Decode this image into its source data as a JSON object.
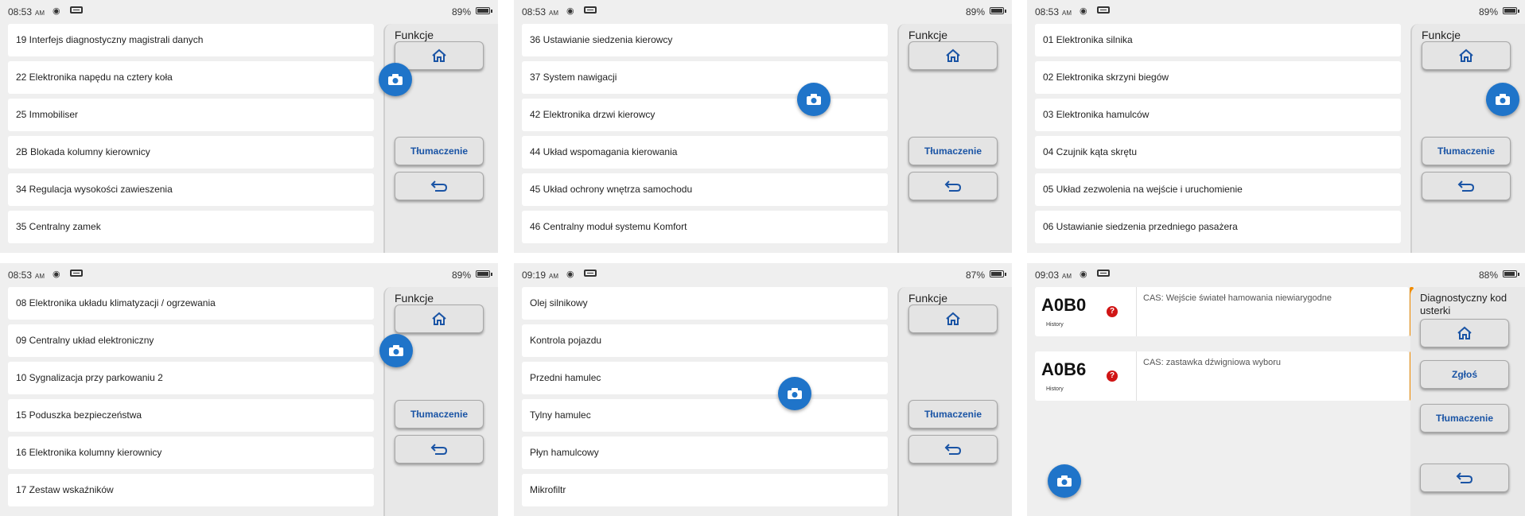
{
  "screens": [
    {
      "status": {
        "time": "08:53",
        "ampm": "AM",
        "battery": "89%",
        "battery_level": 0.89
      },
      "items": [
        "19 Interfejs diagnostyczny magistrali danych",
        "22 Elektronika napędu na cztery koła",
        "25 Immobiliser",
        "2B Blokada kolumny kierownicy",
        "34 Regulacja wysokości zawieszenia",
        "35 Centralny zamek"
      ],
      "panel": {
        "title": "Funkcje",
        "translate_label": "Tłumaczenie"
      }
    },
    {
      "status": {
        "time": "08:53",
        "ampm": "AM",
        "battery": "89%",
        "battery_level": 0.89
      },
      "items": [
        "36 Ustawianie siedzenia kierowcy",
        "37 System nawigacji",
        "42 Elektronika drzwi kierowcy",
        "44 Układ wspomagania kierowania",
        "45 Układ ochrony wnętrza samochodu",
        "46 Centralny moduł systemu Komfort"
      ],
      "panel": {
        "title": "Funkcje",
        "translate_label": "Tłumaczenie"
      }
    },
    {
      "status": {
        "time": "08:53",
        "ampm": "AM",
        "battery": "89%",
        "battery_level": 0.89
      },
      "items": [
        "01 Elektronika silnika",
        "02 Elektronika skrzyni biegów",
        "03 Elektronika hamulców",
        "04 Czujnik kąta skrętu",
        "05 Układ zezwolenia na wejście i uruchomienie",
        "06 Ustawianie siedzenia przedniego pasażera"
      ],
      "panel": {
        "title": "Funkcje",
        "translate_label": "Tłumaczenie"
      }
    },
    {
      "status": {
        "time": "08:53",
        "ampm": "AM",
        "battery": "89%",
        "battery_level": 0.89
      },
      "items": [
        "08 Elektronika układu klimatyzacji / ogrzewania",
        "09 Centralny układ elektroniczny",
        "10 Sygnalizacja przy parkowaniu 2",
        "15 Poduszka bezpieczeństwa",
        "16 Elektronika kolumny kierownicy",
        "17 Zestaw wskaźników"
      ],
      "panel": {
        "title": "Funkcje",
        "translate_label": "Tłumaczenie"
      }
    },
    {
      "status": {
        "time": "09:19",
        "ampm": "AM",
        "battery": "87%",
        "battery_level": 0.87
      },
      "items": [
        "Olej silnikowy",
        "Kontrola pojazdu",
        "Przedni hamulec",
        "Tylny hamulec",
        "Płyn hamulcowy",
        "Mikrofiltr"
      ],
      "panel": {
        "title": "Funkcje",
        "translate_label": "Tłumaczenie"
      }
    }
  ],
  "dtc_screen": {
    "status": {
      "time": "09:03",
      "ampm": "AM",
      "battery": "88%",
      "battery_level": 0.88
    },
    "codes": [
      {
        "code": "A0B0",
        "status": "History",
        "description": "CAS: Wejście świateł hamowania niewiarygodne"
      },
      {
        "code": "A0B6",
        "status": "History",
        "description": "CAS: zastawka dźwigniowa wyboru"
      }
    ],
    "panel": {
      "title": "Diagnostyczny kod usterki",
      "report_label": "Zgłoś",
      "translate_label": "Tłumaczenie"
    }
  },
  "icons": {
    "home": "home-icon",
    "camera": "camera-icon",
    "back": "back-arrow-icon",
    "wifi": "wifi-icon",
    "sd_card": "sd-card-icon",
    "battery": "battery-icon",
    "question": "question-icon"
  },
  "colors": {
    "accent": "#1f74c9",
    "button_text": "#1a54a5",
    "warning_stripe": "#f08c00",
    "alert": "#d01515"
  }
}
